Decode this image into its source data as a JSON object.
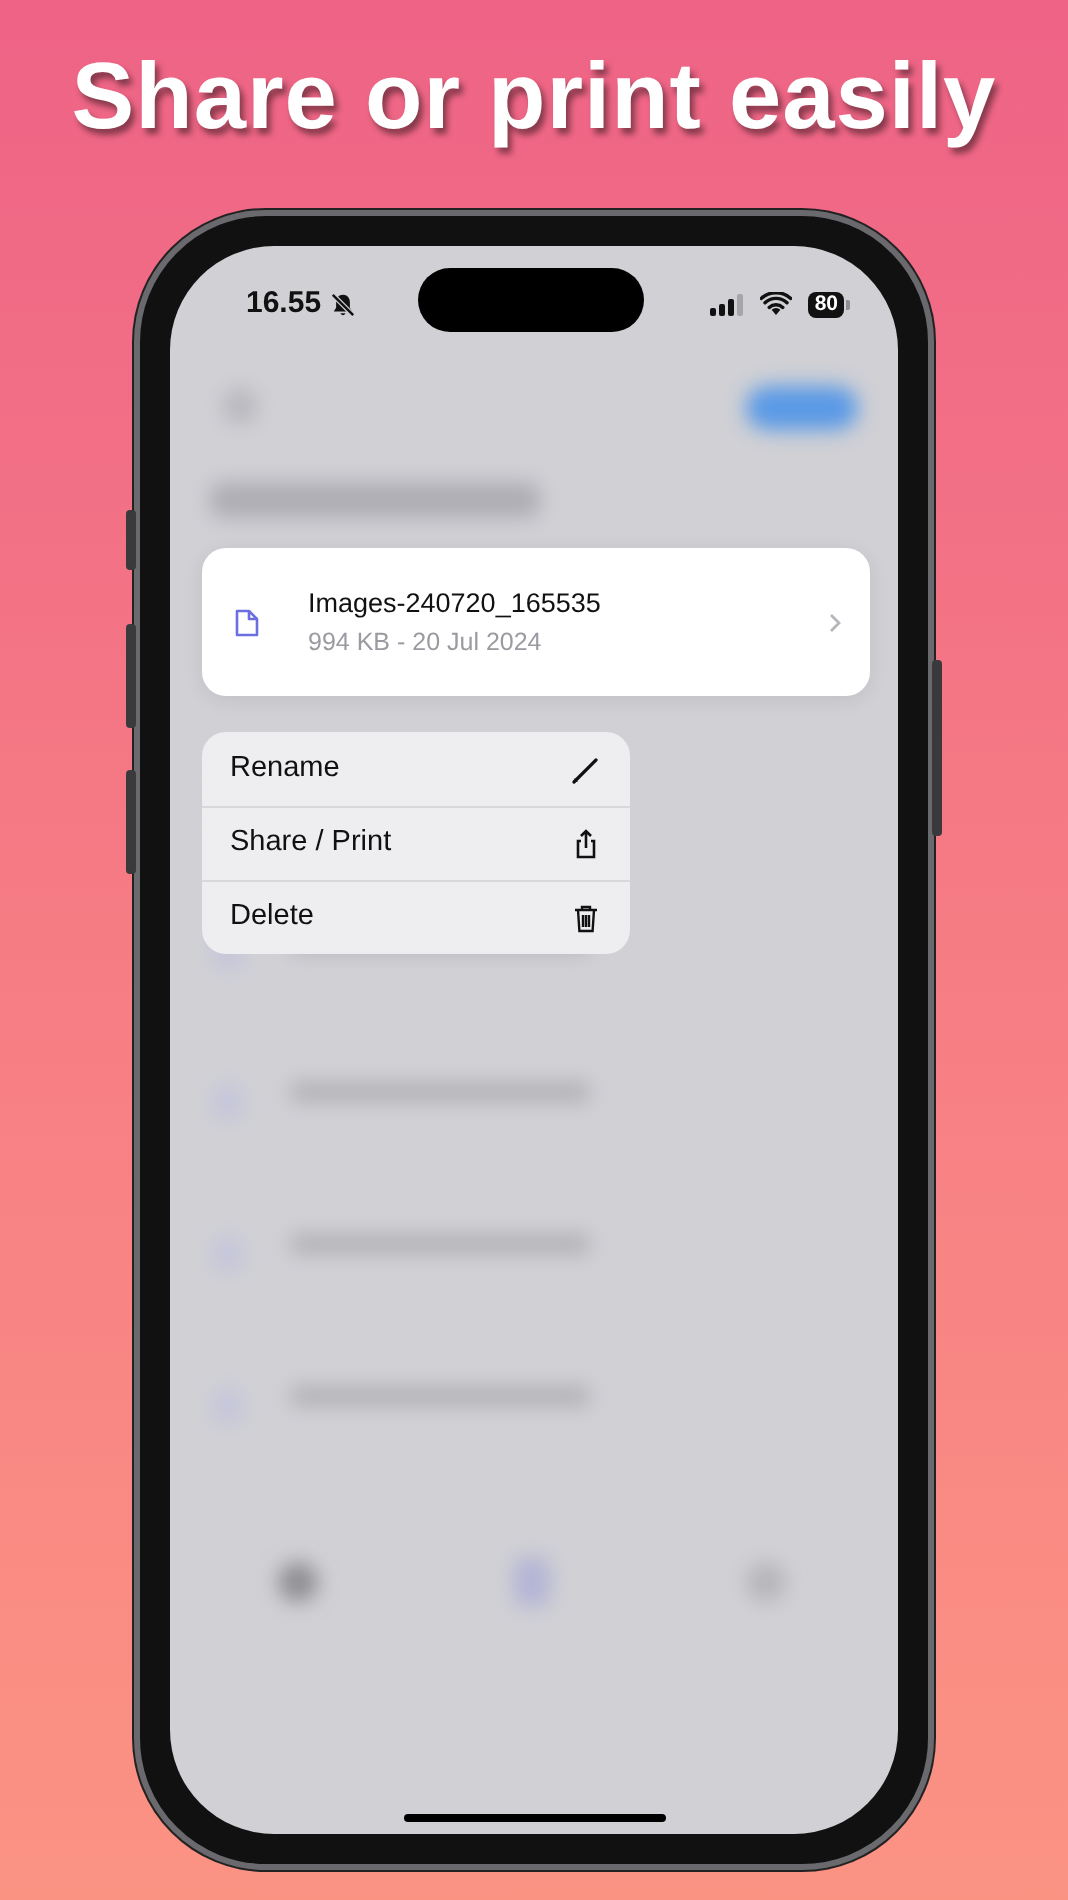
{
  "headline": "Share or print easily",
  "status_bar": {
    "time": "16.55",
    "battery": "80"
  },
  "file": {
    "name": "Images-240720_165535",
    "details": "994 KB - 20 Jul 2024"
  },
  "menu": [
    {
      "label": "Rename",
      "kind": "rename"
    },
    {
      "label": "Share / Print",
      "kind": "share"
    },
    {
      "label": "Delete",
      "kind": "delete"
    }
  ]
}
